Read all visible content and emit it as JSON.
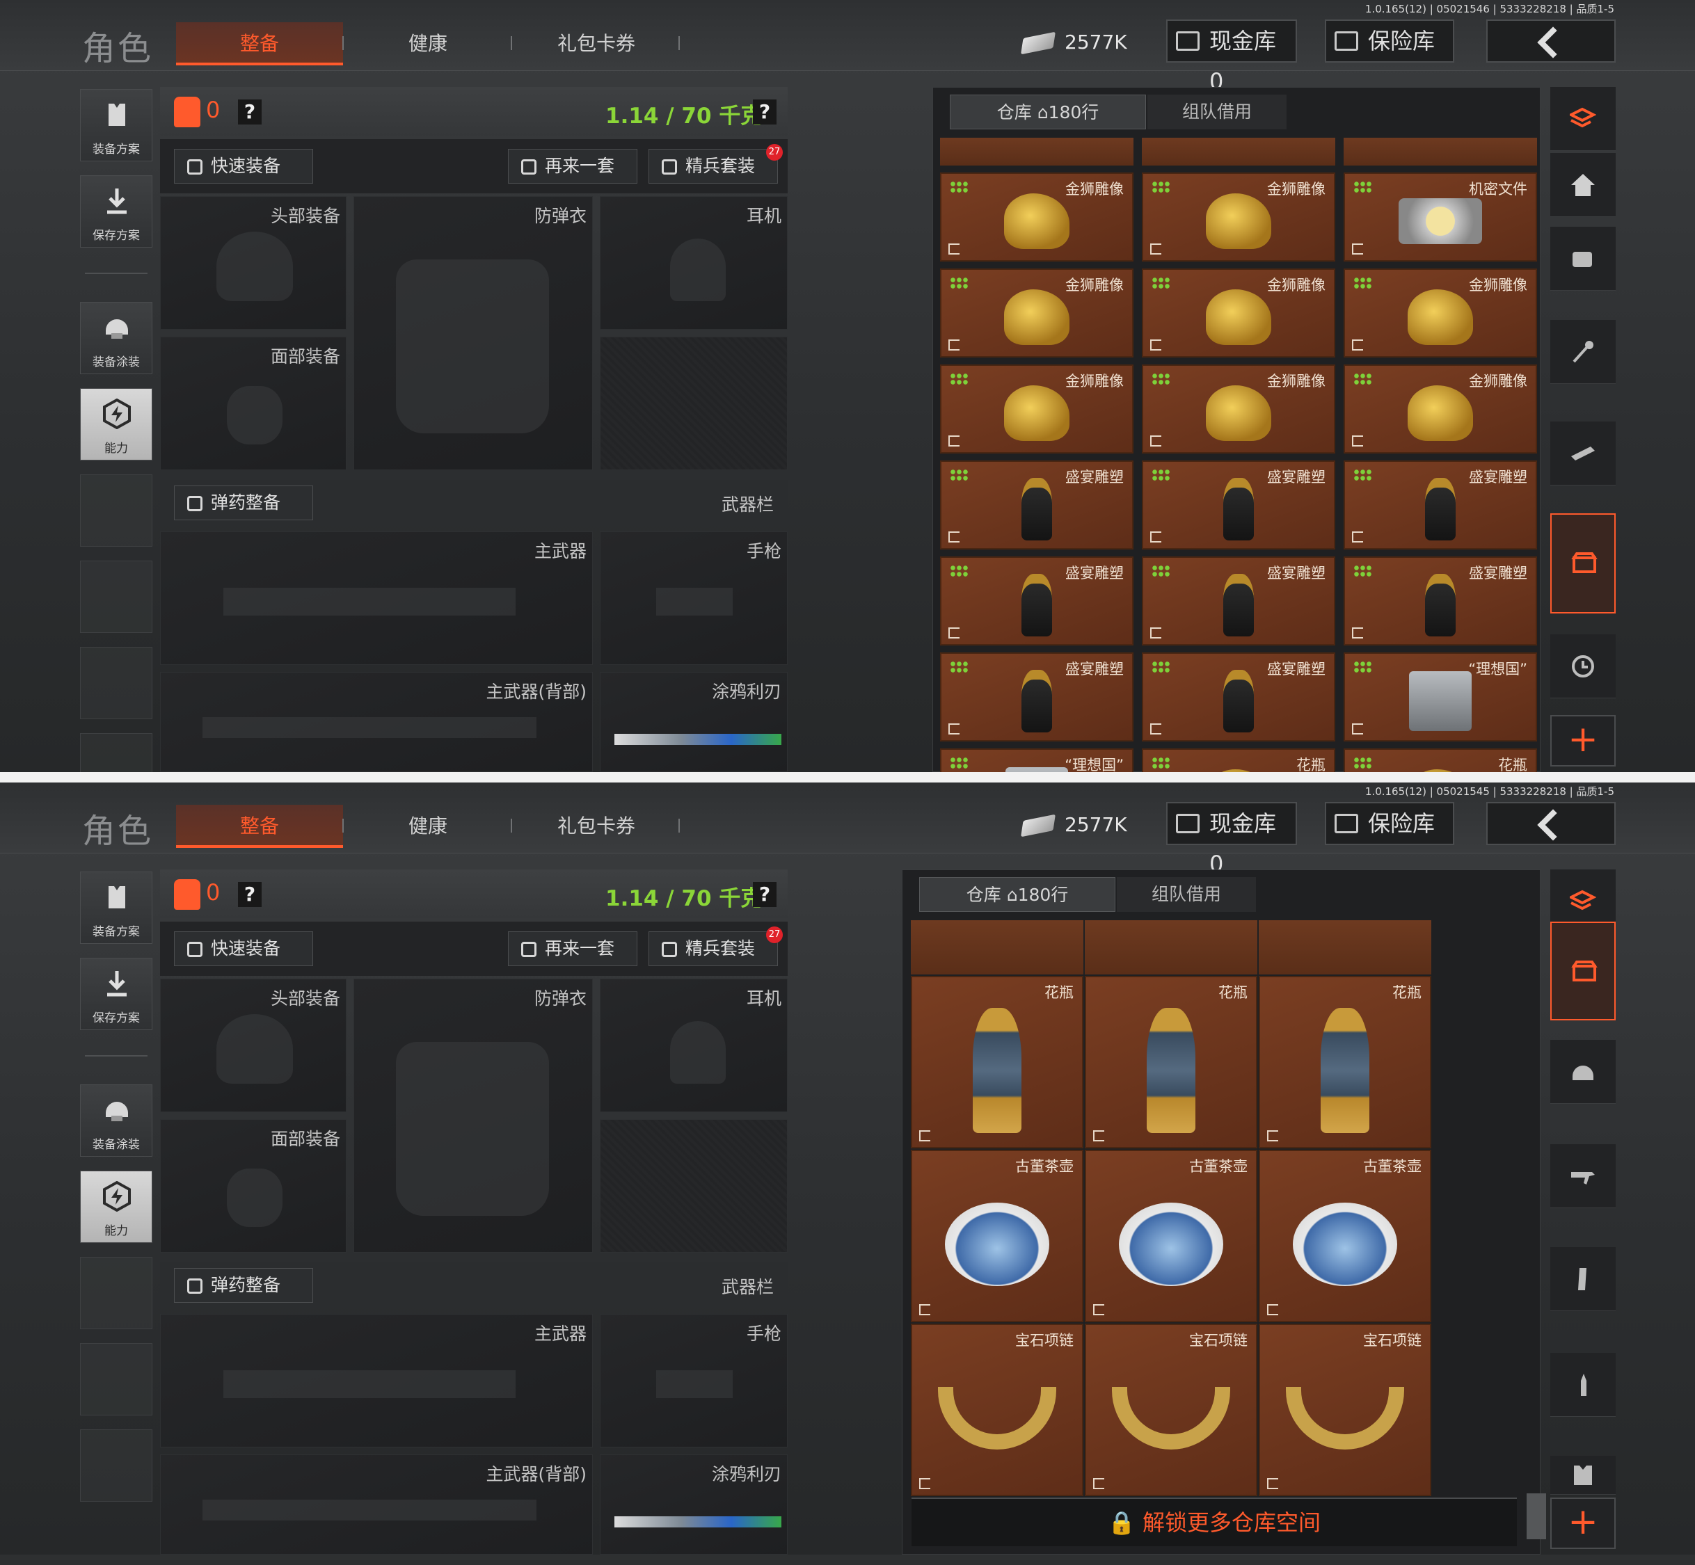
{
  "screens": [
    {
      "version": "1.0.165(12) | 05021546 | 5333228218 | 品质1-5",
      "warehouse_view": "grid"
    },
    {
      "version": "1.0.165(12) | 05021545 | 5333228218 | 品质1-5",
      "warehouse_view": "large"
    }
  ],
  "header": {
    "title": "角色",
    "tabs": [
      "整备",
      "健康",
      "礼包卡券"
    ],
    "active_tab": "整备",
    "money": "2577K",
    "cash_vault": "现金库 0",
    "safe_vault": "保险库"
  },
  "left_sidebar": {
    "items": [
      {
        "label": "装备方案",
        "icon": "vest-plan-icon"
      },
      {
        "label": "保存方案",
        "icon": "download-icon"
      },
      {
        "label": "装备涂装",
        "icon": "paint-helmet-icon"
      },
      {
        "label": "能力",
        "icon": "lightning-hex-icon"
      }
    ]
  },
  "loadout": {
    "backpack_count": "0",
    "help": "?",
    "weight": "1.14 / 70 千克",
    "quick_equip": "快速装备",
    "again": "再来一套",
    "elite": "精兵套装",
    "elite_badge": "27",
    "slots": {
      "head": "头部装备",
      "armor": "防弹衣",
      "headset": "耳机",
      "face": "面部装备"
    },
    "ammo": "弹药整备",
    "weapon_bar": "武器栏",
    "primary": "主武器",
    "pistol": "手枪",
    "primary_back": "主武器(背部)",
    "melee": "涂鸦利刃"
  },
  "warehouse": {
    "tab_storage": "仓库",
    "rows": "180行",
    "tab_team": "组队借用",
    "unlock": "解锁更多仓库空间",
    "grid_items": [
      [
        "金狮雕像",
        "金狮雕像",
        "机密文件"
      ],
      [
        "金狮雕像",
        "金狮雕像",
        "金狮雕像"
      ],
      [
        "金狮雕像",
        "金狮雕像",
        "金狮雕像"
      ],
      [
        "盛宴雕塑",
        "盛宴雕塑",
        "盛宴雕塑"
      ],
      [
        "盛宴雕塑",
        "盛宴雕塑",
        "盛宴雕塑"
      ],
      [
        "盛宴雕塑",
        "盛宴雕塑",
        "“理想国”"
      ],
      [
        "“理想国”",
        "花瓶",
        "花瓶"
      ]
    ],
    "large_items": [
      [
        "花瓶",
        "花瓶",
        "花瓶"
      ],
      [
        "古董茶壶",
        "古董茶壶",
        "古董茶壶"
      ],
      [
        "宝石项链",
        "宝石项链",
        "宝石项链"
      ]
    ]
  },
  "colors": {
    "accent": "#ff5a2c",
    "weight_green": "#8bd638",
    "item_bg": "#6b3520"
  }
}
